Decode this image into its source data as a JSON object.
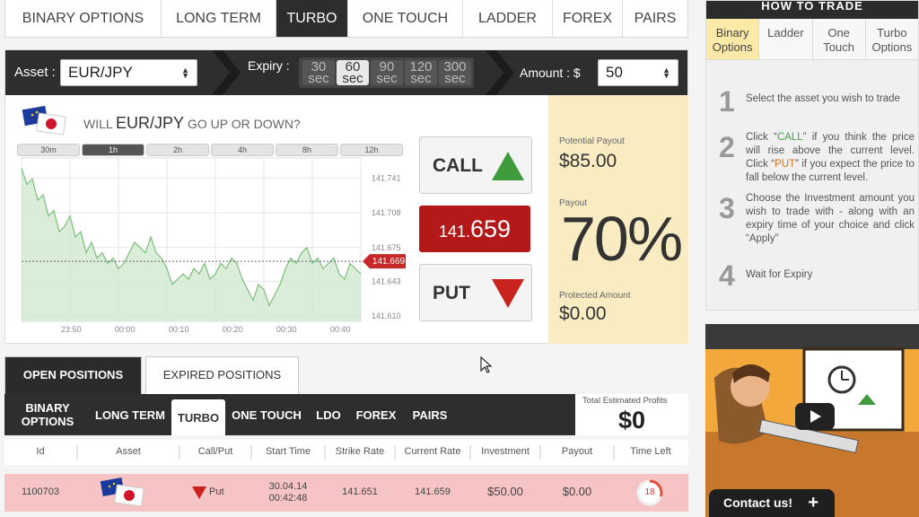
{
  "top_tabs": [
    {
      "label": "BINARY OPTIONS",
      "active": false
    },
    {
      "label": "LONG TERM",
      "active": false
    },
    {
      "label": "TURBO",
      "active": true
    },
    {
      "label": "ONE TOUCH",
      "active": false
    },
    {
      "label": "LADDER",
      "active": false
    },
    {
      "label": "FOREX",
      "active": false
    },
    {
      "label": "PAIRS",
      "active": false
    }
  ],
  "how_to_trade": {
    "title": "HOW TO TRADE",
    "tabs": [
      {
        "label": "Binary Options",
        "active": true
      },
      {
        "label": "Ladder",
        "active": false
      },
      {
        "label": "One Touch",
        "active": false
      },
      {
        "label": "Turbo Options",
        "active": false
      }
    ],
    "steps": [
      {
        "num": "1",
        "text": "Select the asset you wish to trade"
      },
      {
        "num": "2",
        "text_a": "Click “",
        "call": "CALL",
        "text_b": "” if you think the price will rise above the current level. Click “",
        "put": "PUT",
        "text_c": "” if you expect the price to fall below the current level."
      },
      {
        "num": "3",
        "text": "Choose the Investment amount you wish to trade with - along with an expiry time of your choice and click “Apply”"
      },
      {
        "num": "4",
        "text": "Wait for Expiry"
      }
    ]
  },
  "trade_bar": {
    "asset_label": "Asset :",
    "asset_value": "EUR/JPY",
    "expiry_label": "Expiry :",
    "expiry_options": [
      {
        "value": "30",
        "unit": "sec",
        "active": false
      },
      {
        "value": "60",
        "unit": "sec",
        "active": true
      },
      {
        "value": "90",
        "unit": "sec",
        "active": false
      },
      {
        "value": "120",
        "unit": "sec",
        "active": false
      },
      {
        "value": "300",
        "unit": "sec",
        "active": false
      }
    ],
    "amount_label": "Amount : $",
    "amount_value": "50"
  },
  "question": {
    "will": "WILL",
    "asset": "EUR/JPY",
    "suffix": "GO UP OR DOWN?"
  },
  "ranges": [
    {
      "label": "30m",
      "active": false
    },
    {
      "label": "1h",
      "active": true
    },
    {
      "label": "2h",
      "active": false
    },
    {
      "label": "4h",
      "active": false
    },
    {
      "label": "8h",
      "active": false
    },
    {
      "label": "12h",
      "active": false
    }
  ],
  "chart_data": {
    "type": "area",
    "x_ticks": [
      "23:50",
      "00:00",
      "00:10",
      "00:20",
      "00:30",
      "00:40"
    ],
    "y_ticks": [
      141.741,
      141.708,
      141.675,
      141.643,
      141.61
    ],
    "ylim": [
      141.605,
      141.76
    ],
    "current_label": "141.669",
    "current_value": 141.662,
    "values": [
      141.75,
      141.735,
      141.74,
      141.72,
      141.725,
      141.705,
      141.71,
      141.69,
      141.695,
      141.705,
      141.685,
      141.69,
      141.67,
      141.68,
      141.665,
      141.67,
      141.66,
      141.665,
      141.655,
      141.66,
      141.67,
      141.68,
      141.675,
      141.67,
      141.685,
      141.67,
      141.665,
      141.655,
      141.64,
      141.645,
      141.65,
      141.645,
      141.655,
      141.65,
      141.66,
      141.645,
      141.65,
      141.66,
      141.655,
      141.665,
      141.66,
      141.645,
      141.635,
      141.625,
      141.64,
      141.635,
      141.62,
      141.63,
      141.64,
      141.655,
      141.665,
      141.66,
      141.67,
      141.675,
      141.66,
      141.665,
      141.655,
      141.66,
      141.665,
      141.65,
      141.645,
      141.66,
      141.655,
      141.65
    ],
    "grid": true
  },
  "call_label": "CALL",
  "put_label": "PUT",
  "rate": {
    "prefix": "141.",
    "main": "659"
  },
  "payout_panel": {
    "potential_label": "Potential Payout",
    "potential_value": "$85.00",
    "payout_label": "Payout",
    "payout_value": "70%",
    "protected_label": "Protected Amount",
    "protected_value": "$0.00"
  },
  "position_tabs": [
    {
      "label": "OPEN POSITIONS",
      "active": true
    },
    {
      "label": "EXPIRED POSITIONS",
      "active": false
    }
  ],
  "sub_tabs": [
    {
      "label": "BINARY OPTIONS",
      "active": false
    },
    {
      "label": "LONG TERM",
      "active": false
    },
    {
      "label": "TURBO",
      "active": true
    },
    {
      "label": "ONE TOUCH",
      "active": false
    },
    {
      "label": "LDO",
      "active": false
    },
    {
      "label": "FOREX",
      "active": false
    },
    {
      "label": "PAIRS",
      "active": false
    }
  ],
  "profit": {
    "label": "Total Estimated Profits",
    "value": "$0"
  },
  "table": {
    "headers": [
      "Id",
      "Asset",
      "Call/Put",
      "Start Time",
      "Strike Rate",
      "Current Rate",
      "Investment",
      "Payout",
      "Time Left"
    ],
    "rows": [
      {
        "id": "1100703",
        "direction": "Put",
        "start_date": "30.04.14",
        "start_time": "00:42:48",
        "strike": "141.651",
        "current": "141.659",
        "investment": "$50.00",
        "payout": "$0.00",
        "time_left": "18",
        "time_fraction": 0.3
      }
    ]
  },
  "contact_label": "Contact us!",
  "colors": {
    "call": "#3f9b3c",
    "put": "#c9231f",
    "rate_bg": "#b31919",
    "payout_bg": "#f9ebc2",
    "row_bg": "#f6c4c4"
  }
}
